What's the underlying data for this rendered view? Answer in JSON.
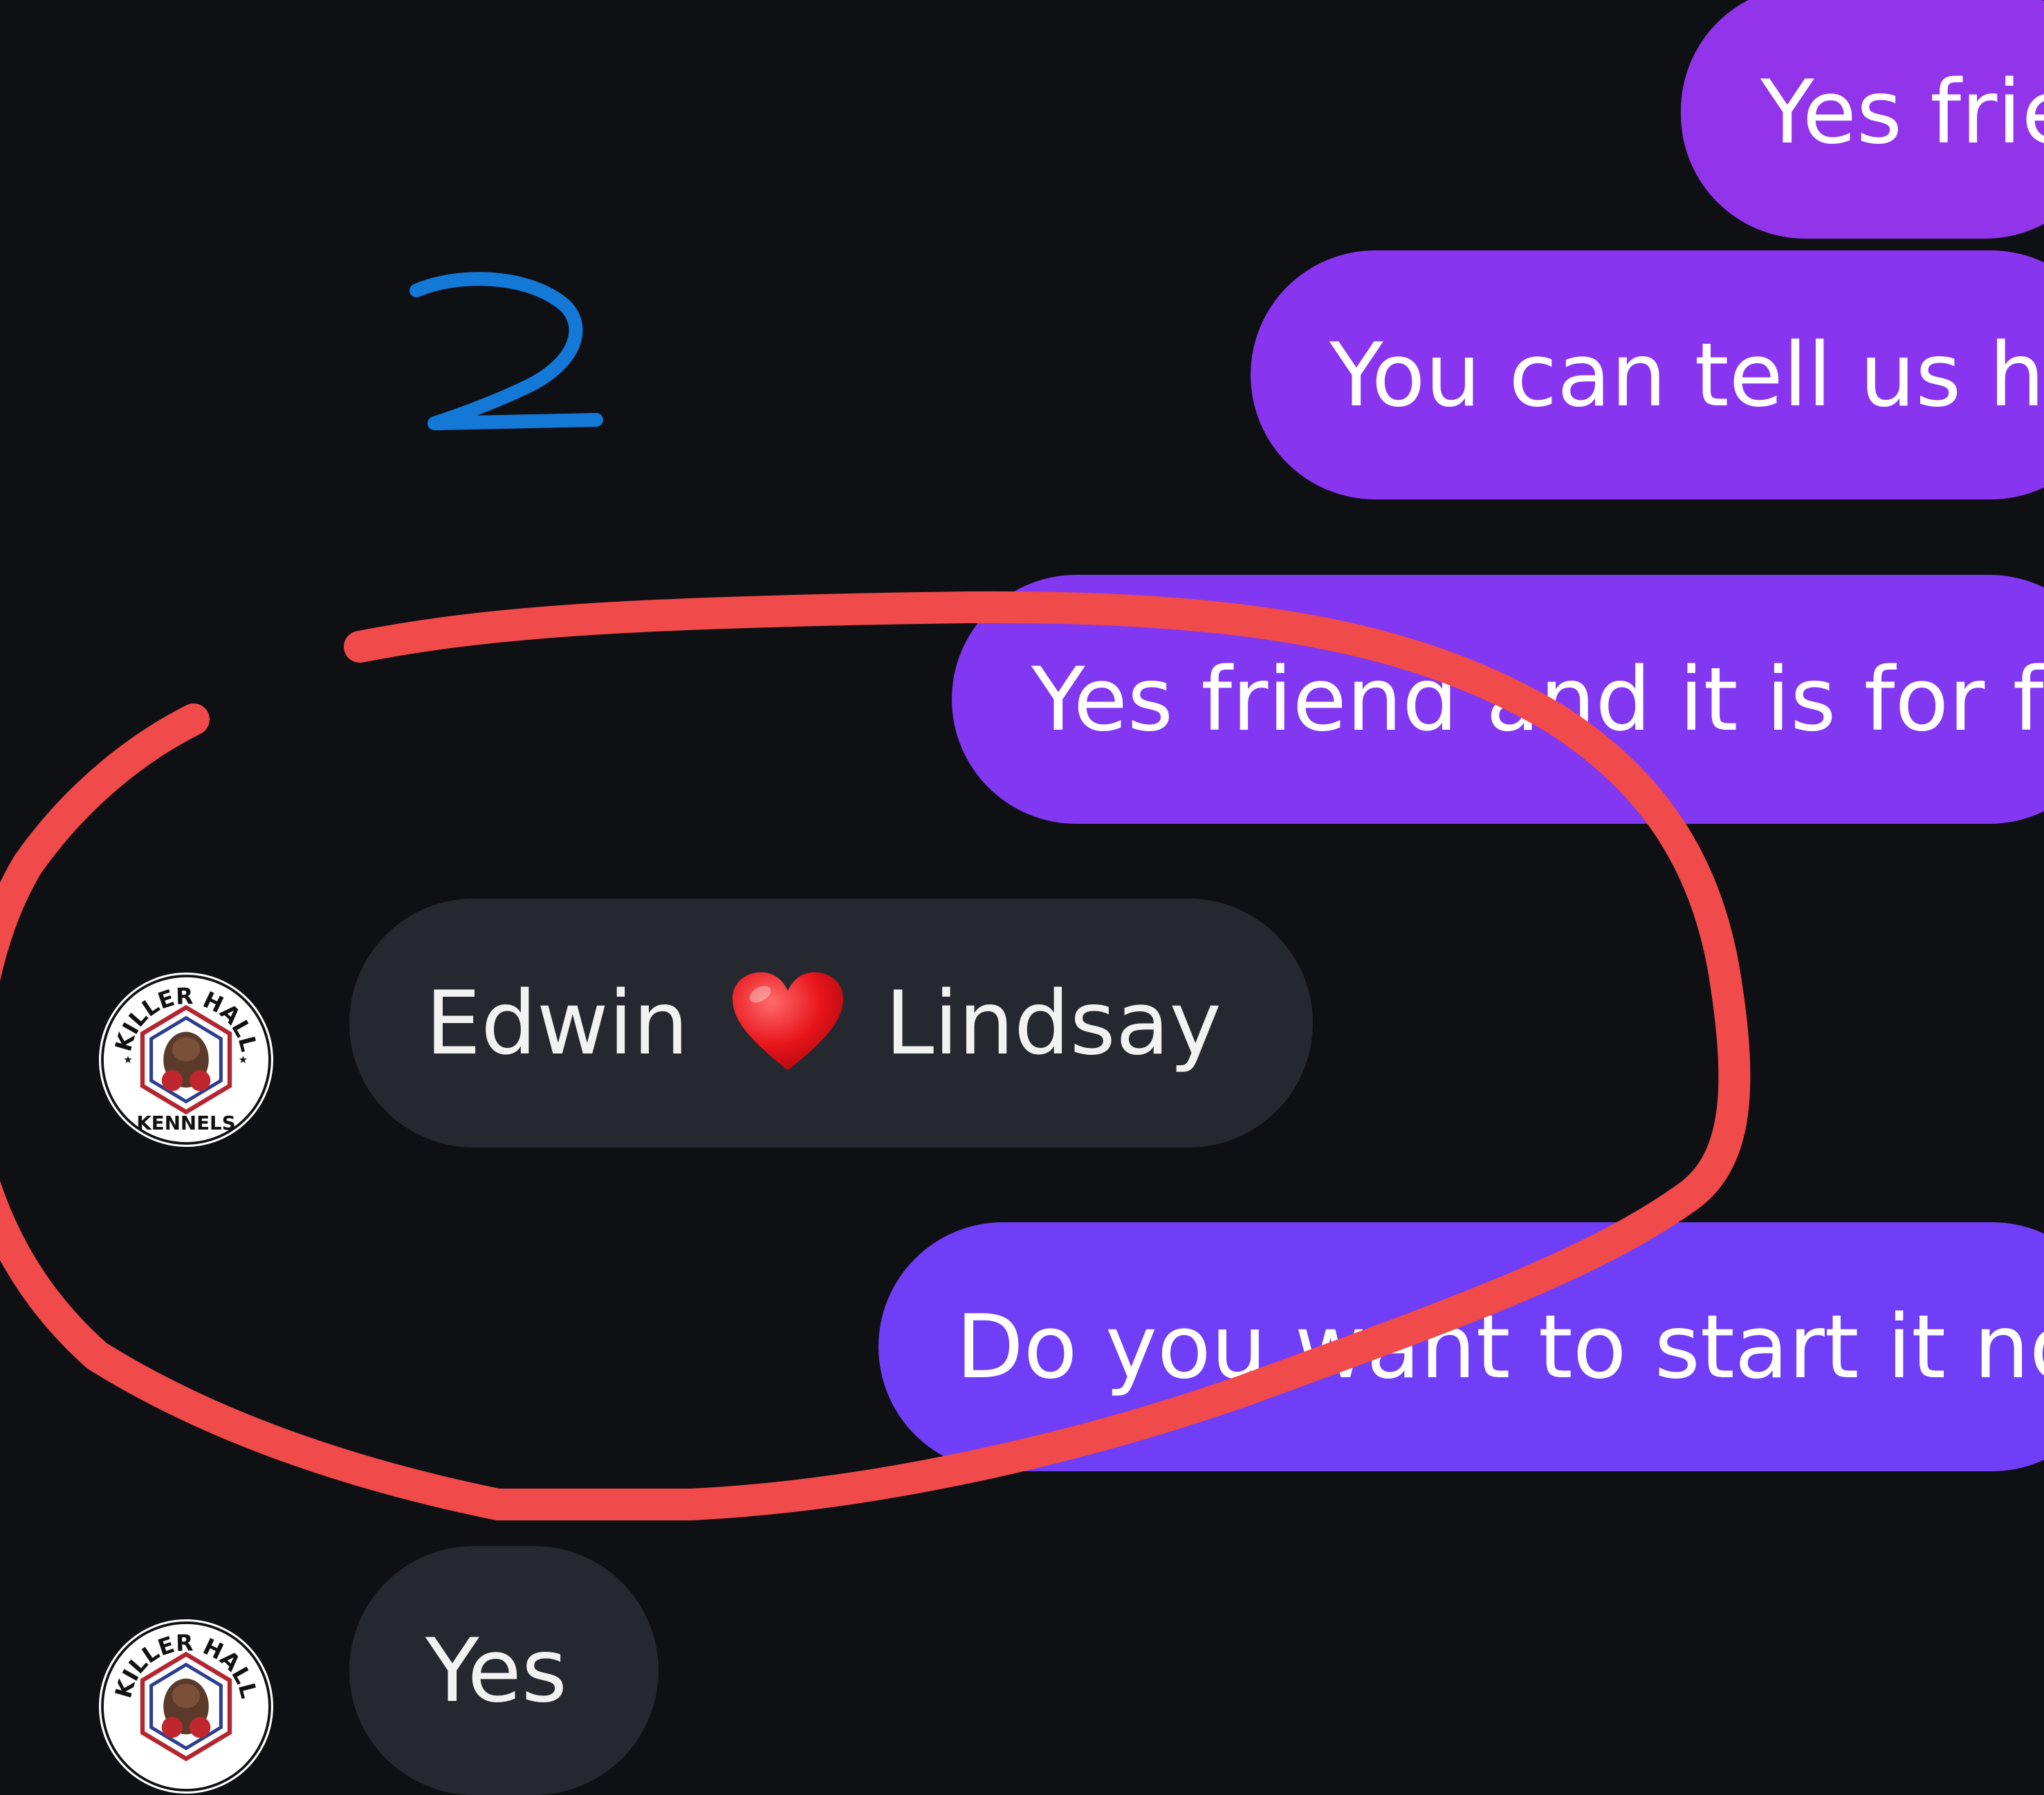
{
  "conversation": {
    "messages": [
      {
        "direction": "outgoing",
        "text": "Yes frie"
      },
      {
        "direction": "outgoing",
        "text": "You can tell us h"
      },
      {
        "direction": "outgoing",
        "text": "Yes friend and it is for f"
      },
      {
        "direction": "incoming",
        "name_left": "Edwin",
        "emoji": "❤️",
        "name_right": "Lindsay"
      },
      {
        "direction": "outgoing",
        "text": "Do you want to start it no"
      },
      {
        "direction": "incoming",
        "text": "Yes"
      }
    ],
    "avatar": {
      "icon": "kennel-logo-avatar",
      "logo_text_top": "KILLER HALL",
      "logo_text_bottom": "KENNELS"
    }
  },
  "annotations": {
    "number_label": "2",
    "number_color": "#1478d6",
    "circle_color": "#f04a4a"
  },
  "colors": {
    "background": "#0e1014",
    "outgoing_bubble_top": "#9236ea",
    "outgoing_bubble_bottom": "#7040f6",
    "incoming_bubble": "#25282e"
  }
}
